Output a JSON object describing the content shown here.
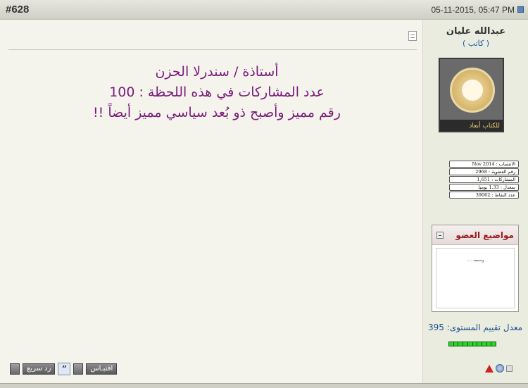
{
  "header": {
    "post_number": "#628",
    "date": "05-11-2015, 05:47 PM"
  },
  "post": {
    "lines": [
      "أستاذة / سندرلا الحزن",
      "عدد المشاركات في هذه اللحظة : 100",
      "رقم مميز وأصبح ذو بُعد سياسي مميز أيضاً !!"
    ],
    "text_color": "#7a1a7a"
  },
  "actions": {
    "quick_reply": "رد سريع",
    "quote": "اقتبـاس"
  },
  "user": {
    "name": "عبدالله عليان",
    "title": "( كاتب )",
    "avatar_text": "للكتاب أبعاد",
    "stats": [
      "الانتساب : Nov 2014",
      "رقم العضوية : 2968",
      "المشاركات : 1,651",
      "بمعدل : 1.33 يوميا",
      "عدد النقاط : 39062"
    ],
    "topics_title": "مواضيع العضو",
    "topics": [
      "وجميعه ، ..."
    ],
    "rating_label": "معدل تقييم المستوى: 395",
    "rating_fill": 1.0
  },
  "colors": {
    "accent": "#1c4f8c",
    "topics_title": "#9a1b1b",
    "rating_green": "#2ed02e"
  }
}
